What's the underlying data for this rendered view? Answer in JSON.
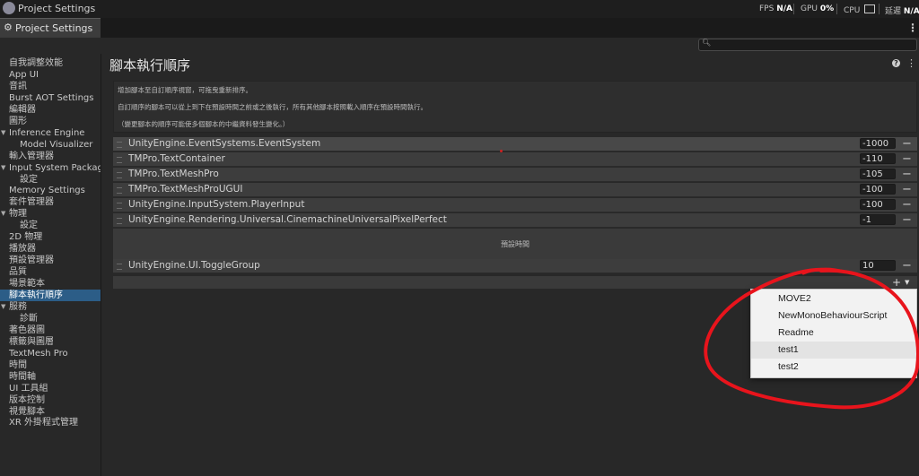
{
  "titlebar": {
    "title": "Project Settings",
    "fps_label": "FPS",
    "fps_value": "N/A",
    "gpu_label": "GPU",
    "gpu_value": "0%",
    "cpu_label": "CPU",
    "latency_label": "延遲",
    "latency_value": "N/A"
  },
  "tab": {
    "label": "Project Settings"
  },
  "sidebar": {
    "items": [
      {
        "label": "自我調整效能",
        "indent": 0
      },
      {
        "label": "App UI",
        "indent": 0
      },
      {
        "label": "音訊",
        "indent": 0
      },
      {
        "label": "Burst AOT Settings",
        "indent": 0
      },
      {
        "label": "編輯器",
        "indent": 0
      },
      {
        "label": "圖形",
        "indent": 0
      },
      {
        "label": "Inference Engine",
        "indent": 0,
        "expandable": true
      },
      {
        "label": "Model Visualizer",
        "indent": 1
      },
      {
        "label": "輸入管理器",
        "indent": 0
      },
      {
        "label": "Input System Package",
        "indent": 0,
        "expandable": true
      },
      {
        "label": "設定",
        "indent": 1
      },
      {
        "label": "Memory Settings",
        "indent": 0
      },
      {
        "label": "套件管理器",
        "indent": 0
      },
      {
        "label": "物理",
        "indent": 0,
        "expandable": true
      },
      {
        "label": "設定",
        "indent": 1
      },
      {
        "label": "2D 物理",
        "indent": 0
      },
      {
        "label": "播放器",
        "indent": 0
      },
      {
        "label": "預設管理器",
        "indent": 0
      },
      {
        "label": "品質",
        "indent": 0
      },
      {
        "label": "場景範本",
        "indent": 0
      },
      {
        "label": "腳本執行順序",
        "indent": 0,
        "selected": true
      },
      {
        "label": "服務",
        "indent": 0,
        "expandable": true
      },
      {
        "label": "診斷",
        "indent": 1
      },
      {
        "label": "著色器圖",
        "indent": 0
      },
      {
        "label": "標籤與圖層",
        "indent": 0
      },
      {
        "label": "TextMesh Pro",
        "indent": 0
      },
      {
        "label": "時間",
        "indent": 0
      },
      {
        "label": "時間軸",
        "indent": 0
      },
      {
        "label": "UI 工具組",
        "indent": 0
      },
      {
        "label": "版本控制",
        "indent": 0
      },
      {
        "label": "視覺腳本",
        "indent": 0
      },
      {
        "label": "XR 外掛程式管理",
        "indent": 0
      }
    ]
  },
  "main": {
    "title": "腳本執行順序",
    "help_lines": [
      "增加腳本至自訂順序視窗，可拖曳重新排序。",
      "自訂順序的腳本可以從上到下在預設時間之前或之後執行，所有其他腳本按照載入順序在預設時間執行。",
      "（變更腳本的順序可能使多個腳本的中繼資料發生變化。）"
    ],
    "scripts": [
      {
        "name": "UnityEngine.EventSystems.EventSystem",
        "order": "-1000"
      },
      {
        "name": "TMPro.TextContainer",
        "order": "-110"
      },
      {
        "name": "TMPro.TextMeshPro",
        "order": "-105"
      },
      {
        "name": "TMPro.TextMeshProUGUI",
        "order": "-100"
      },
      {
        "name": "UnityEngine.InputSystem.PlayerInput",
        "order": "-100"
      },
      {
        "name": "UnityEngine.Rendering.Universal.CinemachineUniversalPixelPerfect",
        "order": "-1"
      }
    ],
    "default_time_label": "預設時間",
    "after_scripts": [
      {
        "name": "UnityEngine.UI.ToggleGroup",
        "order": "10"
      }
    ],
    "remove_symbol": "−",
    "add_symbol": "+"
  },
  "popup": {
    "items": [
      "MOVE2",
      "NewMonoBehaviourScript",
      "Readme",
      "test1",
      "test2"
    ],
    "highlighted_index": 3
  },
  "colors": {
    "selected_sidebar": "#2c5d87",
    "annotation_circle": "#e8141c"
  }
}
